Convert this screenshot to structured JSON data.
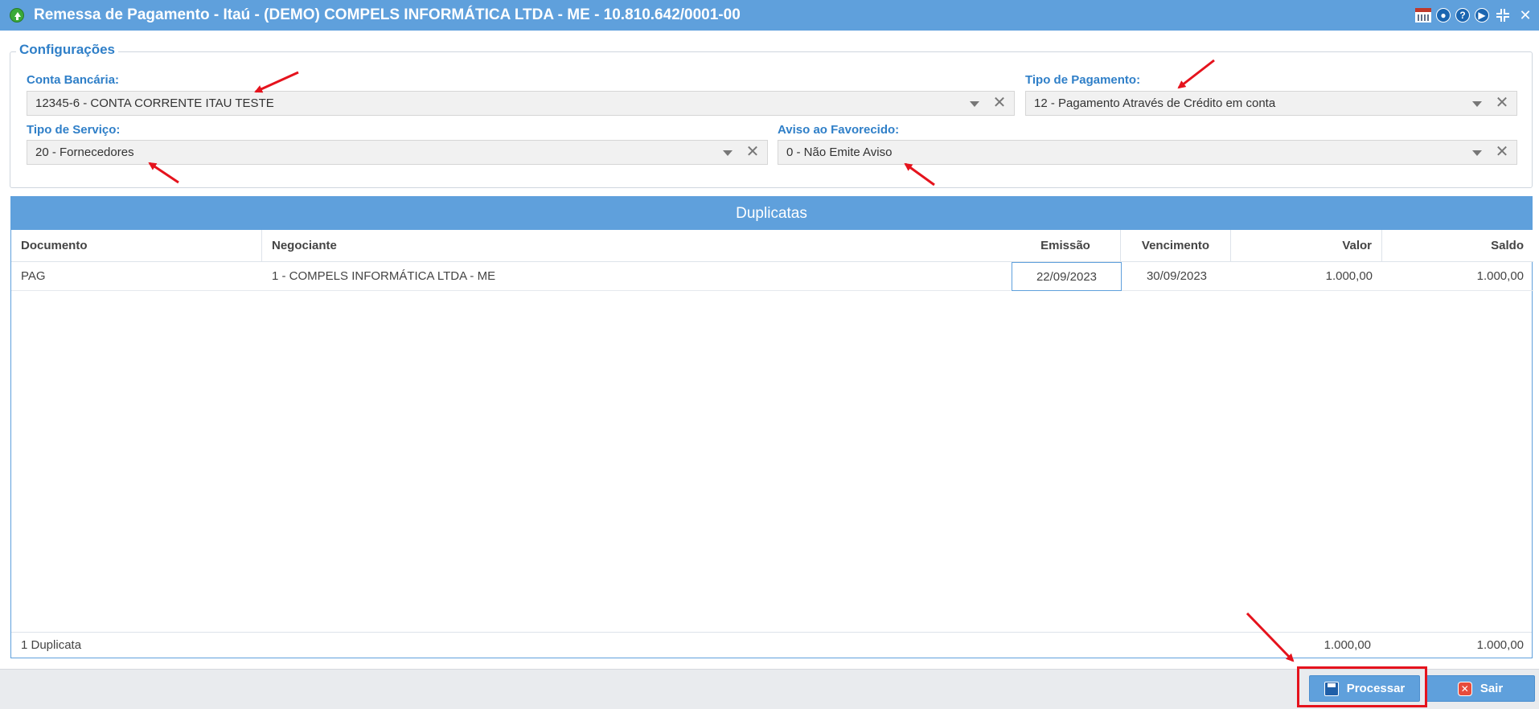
{
  "window": {
    "title": "Remessa de Pagamento - Itaú - (DEMO) COMPELS INFORMÁTICA LTDA - ME - 10.810.642/0001-00",
    "tools": [
      "calendar-icon",
      "chat-icon",
      "help-icon",
      "play-icon",
      "shrink-icon",
      "close-icon"
    ],
    "help_glyph": "?",
    "close_glyph": "✕"
  },
  "config": {
    "legend": "Configurações",
    "conta": {
      "label": "Conta Bancária:",
      "value": "12345-6 - CONTA CORRENTE ITAU TESTE"
    },
    "tipo_pagamento": {
      "label": "Tipo de Pagamento:",
      "value": "12 - Pagamento Através de Crédito em conta"
    },
    "tipo_servico": {
      "label": "Tipo de Serviço:",
      "value": "20 - Fornecedores"
    },
    "aviso": {
      "label": "Aviso ao Favorecido:",
      "value": "0 - Não Emite Aviso"
    },
    "clear_glyph": "✕"
  },
  "grid": {
    "title": "Duplicatas",
    "columns": [
      "Documento",
      "Negociante",
      "Emissão",
      "Vencimento",
      "Valor",
      "Saldo"
    ],
    "rows": [
      {
        "documento": "PAG",
        "negociante": "1 - COMPELS INFORMÁTICA LTDA - ME",
        "emissao": "22/09/2023",
        "vencimento": "30/09/2023",
        "valor": "1.000,00",
        "saldo": "1.000,00"
      }
    ],
    "footer": {
      "count": "1 Duplicata",
      "valor_total": "1.000,00",
      "saldo_total": "1.000,00"
    }
  },
  "actions": {
    "processar": "Processar",
    "sair": "Sair",
    "exit_glyph": "✕"
  },
  "colors": {
    "header_blue": "#5fa0dc",
    "label_blue": "#2f7fc8",
    "annotation_red": "#e5131d"
  }
}
